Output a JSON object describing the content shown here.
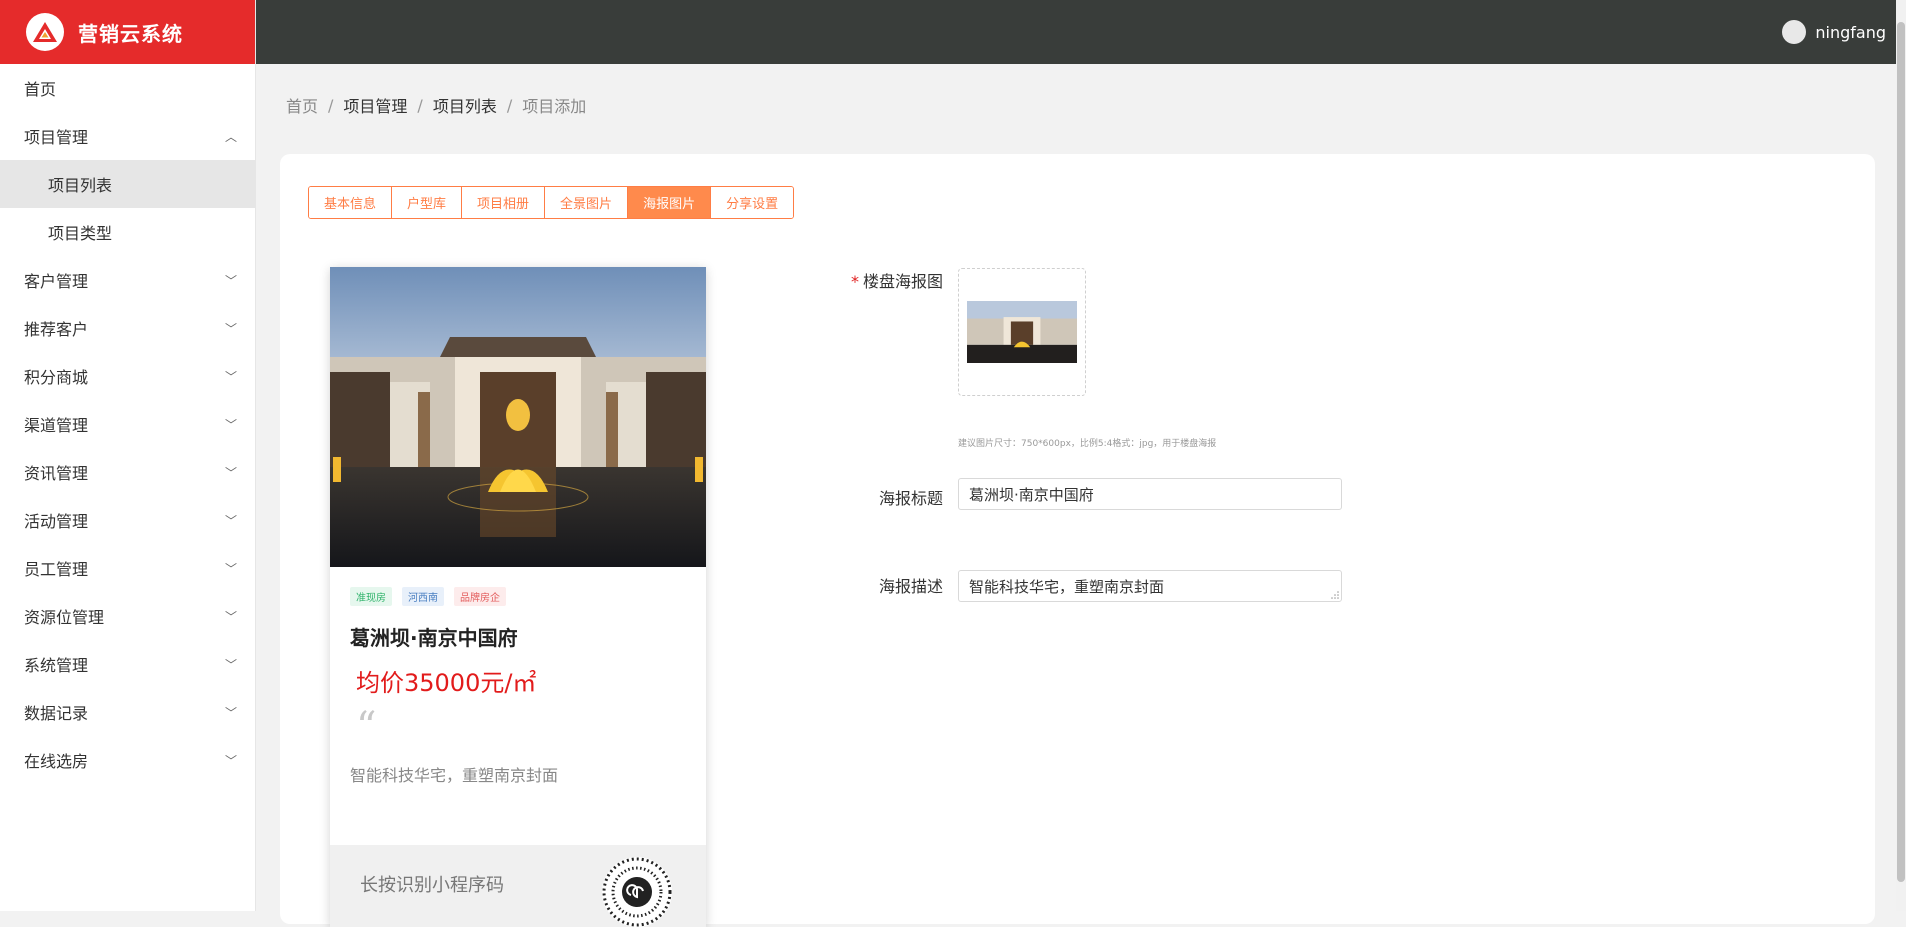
{
  "app": {
    "title": "营销云系统"
  },
  "header": {
    "username": "ningfang"
  },
  "sidebar": {
    "items": [
      {
        "label": "首页"
      },
      {
        "label": "项目管理",
        "expanded": true,
        "children": [
          {
            "label": "项目列表",
            "active": true
          },
          {
            "label": "项目类型"
          }
        ]
      },
      {
        "label": "客户管理"
      },
      {
        "label": "推荐客户"
      },
      {
        "label": "积分商城"
      },
      {
        "label": "渠道管理"
      },
      {
        "label": "资讯管理"
      },
      {
        "label": "活动管理"
      },
      {
        "label": "员工管理"
      },
      {
        "label": "资源位管理"
      },
      {
        "label": "系统管理"
      },
      {
        "label": "数据记录"
      },
      {
        "label": "在线选房"
      }
    ]
  },
  "breadcrumb": [
    "首页",
    "项目管理",
    "项目列表",
    "项目添加"
  ],
  "tabs": [
    {
      "label": "基本信息"
    },
    {
      "label": "户型库"
    },
    {
      "label": "项目相册"
    },
    {
      "label": "全景图片"
    },
    {
      "label": "海报图片",
      "active": true
    },
    {
      "label": "分享设置"
    }
  ],
  "poster": {
    "tags": [
      "准现房",
      "河西南",
      "品牌房企"
    ],
    "title": "葛洲坝·南京中国府",
    "price": "均价35000元/㎡",
    "description": "智能科技华宅，重塑南京封面",
    "footer_text": "长按识别小程序码"
  },
  "form": {
    "image_label": "楼盘海报图",
    "image_hint": "建议图片尺寸：750*600px，比例5:4格式：jpg，用于楼盘海报",
    "title_label": "海报标题",
    "title_value": "葛洲坝·南京中国府",
    "desc_label": "海报描述",
    "desc_value": "智能科技华宅，重塑南京封面"
  },
  "colors": {
    "brand": "#e52b2b",
    "header_bg": "#393d3a",
    "accent": "#ff7d45",
    "price": "#e21b1b"
  }
}
